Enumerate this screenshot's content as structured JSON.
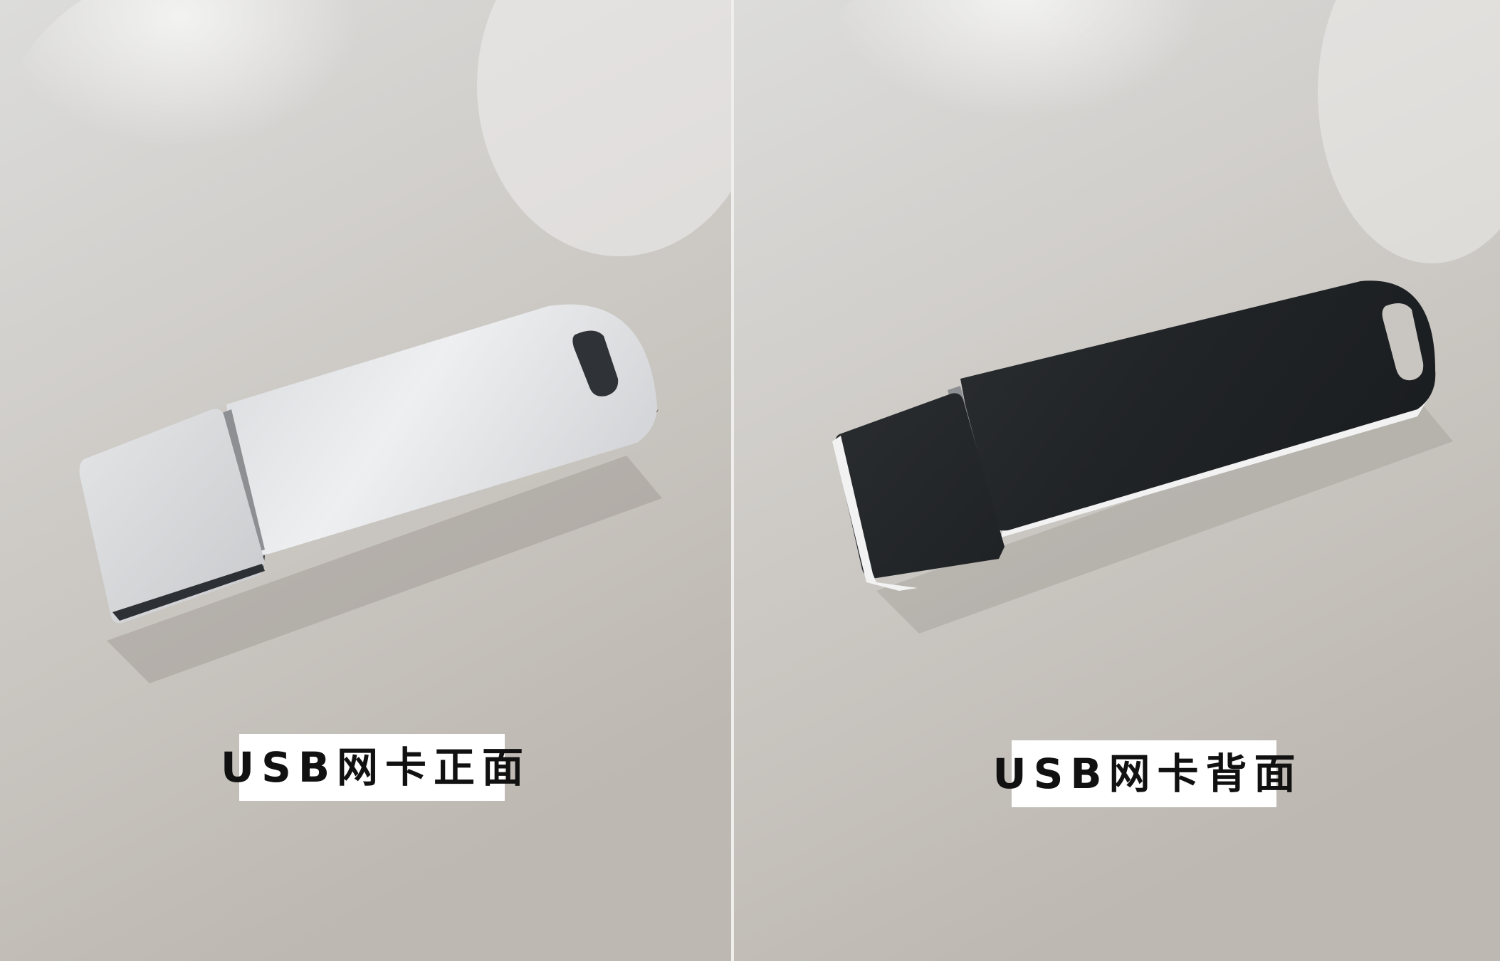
{
  "photos": [
    {
      "caption": "USB网卡正面",
      "device_color": "#e6e7e9",
      "cap_edge_color": "#2d3034"
    },
    {
      "caption": "USB网卡背面",
      "device_color": "#24272a",
      "cap_edge_color": "#f2f2f2"
    }
  ]
}
